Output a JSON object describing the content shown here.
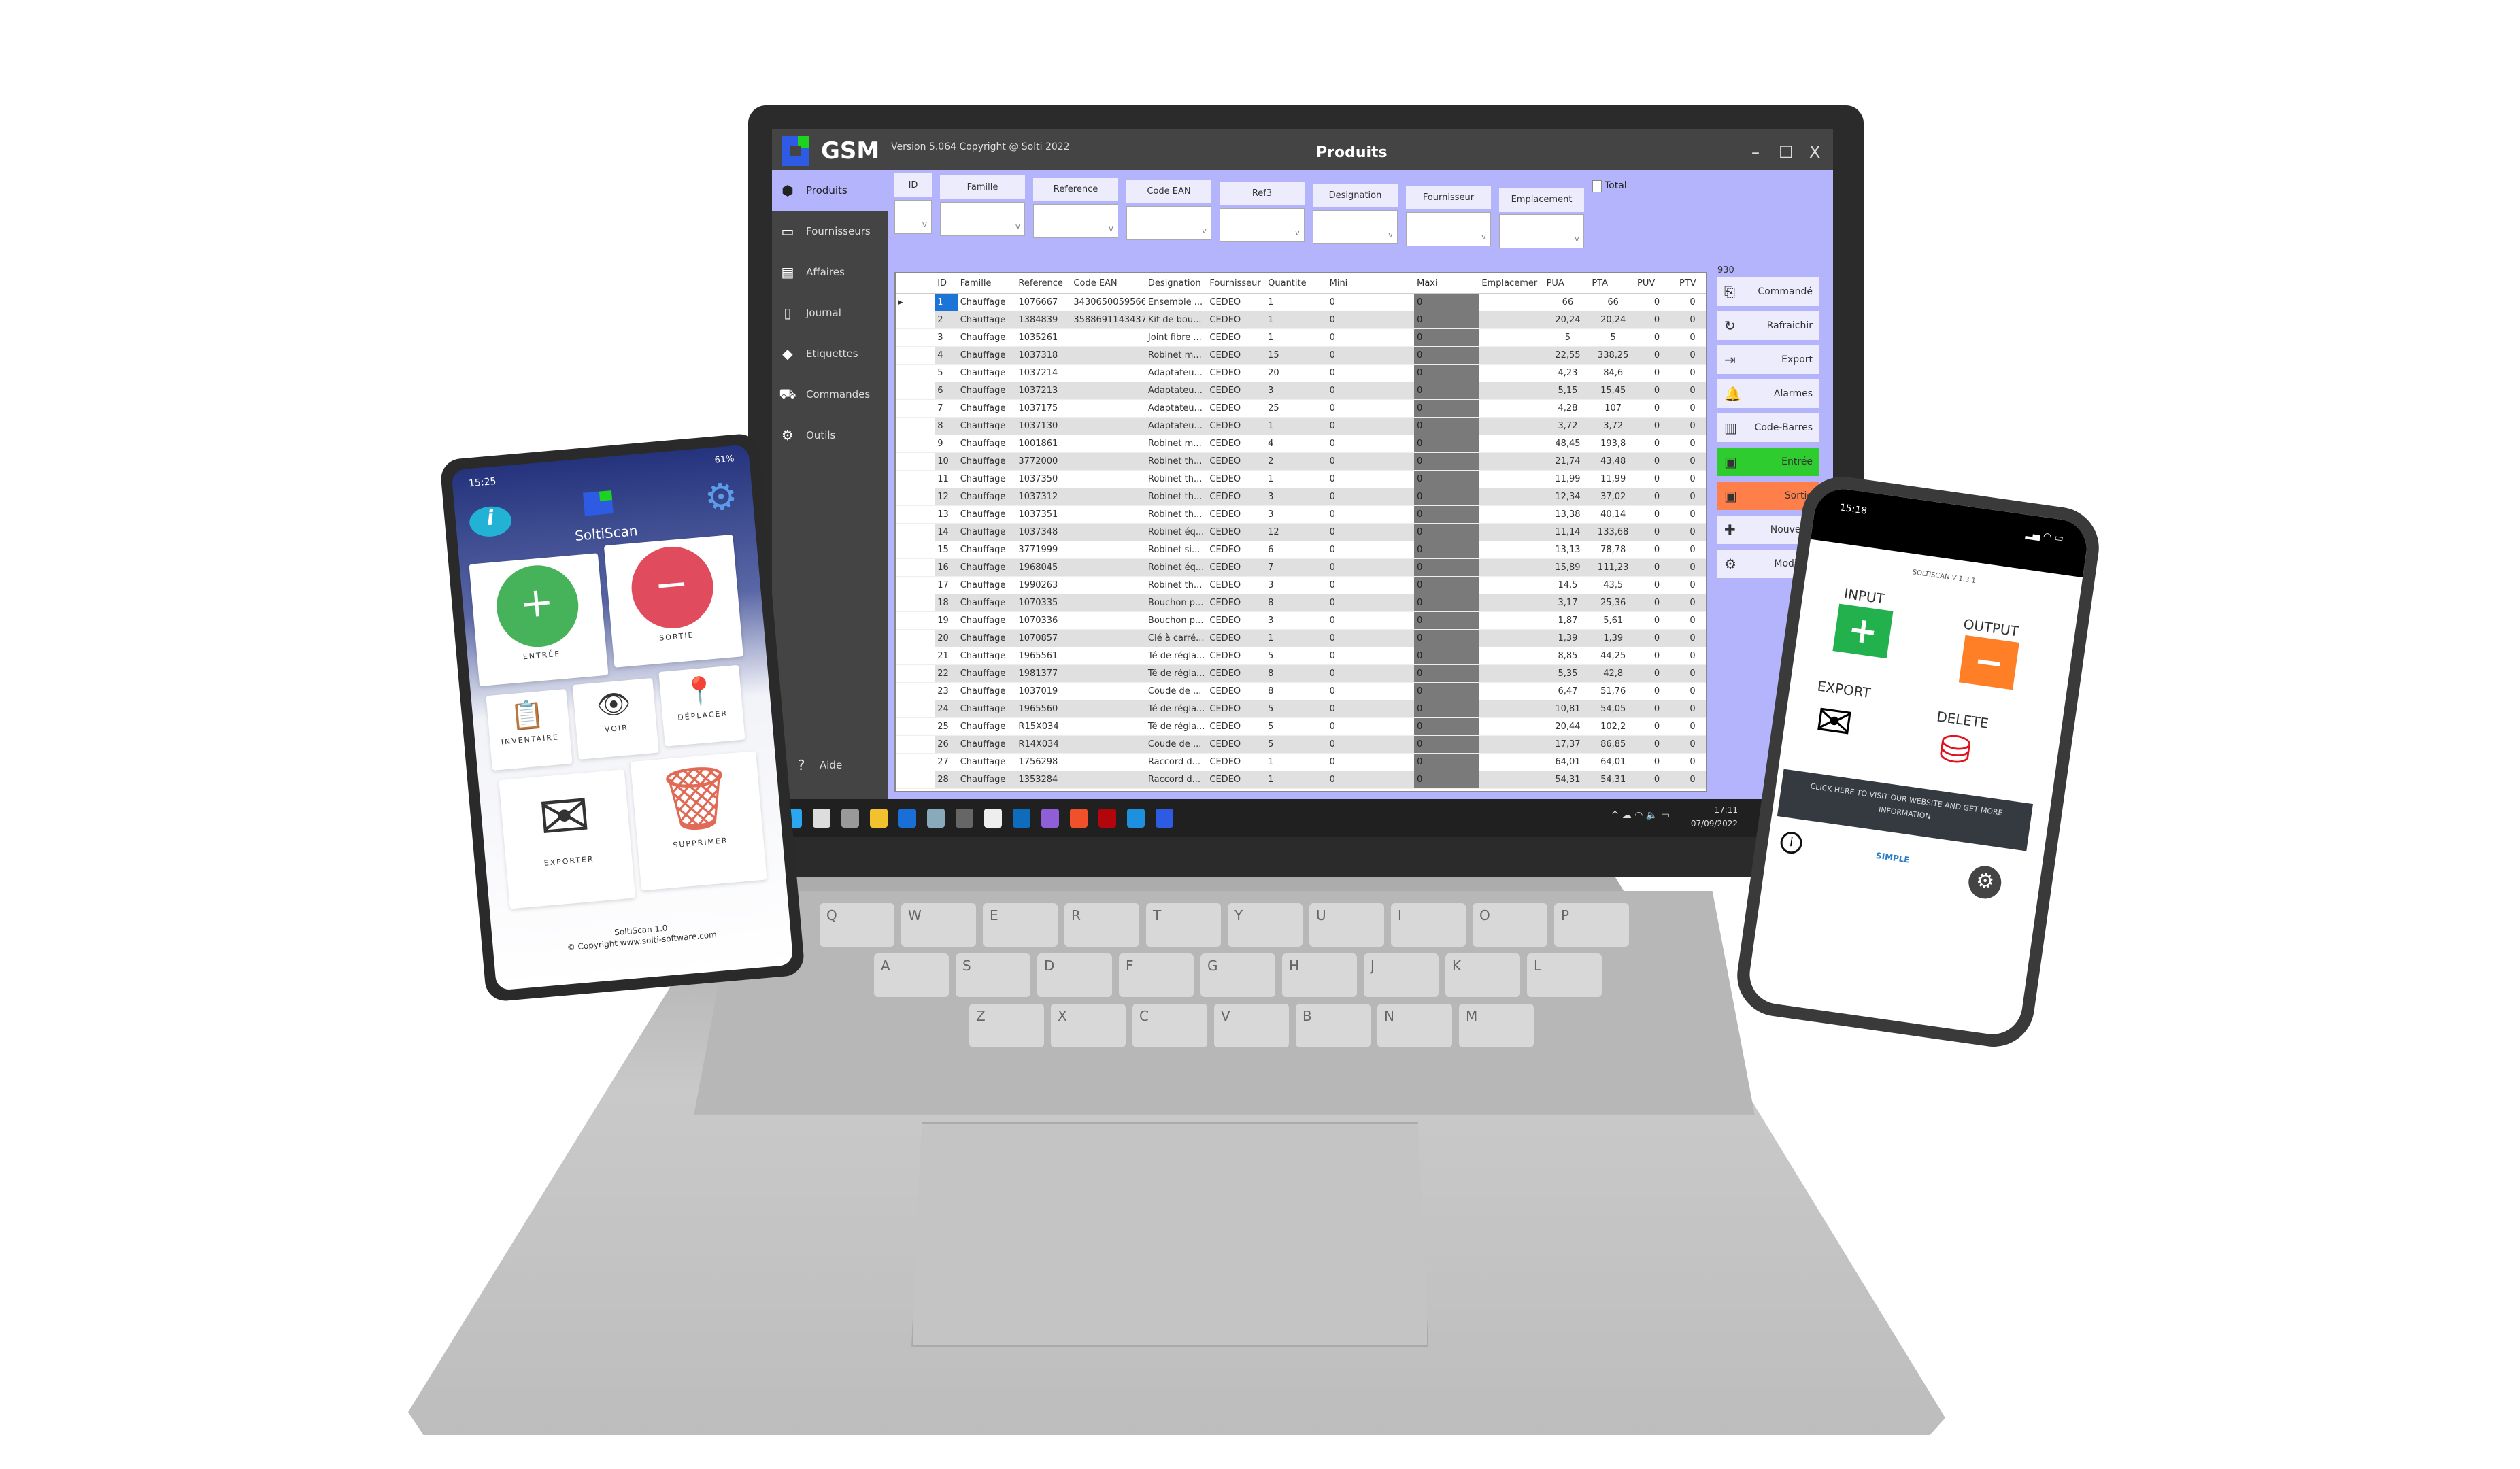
{
  "app": {
    "title": "Produits",
    "version": "Version 5.064  Copyright @ Solti 2022",
    "logo_text": "GSM",
    "window_controls": [
      "–",
      "☐",
      "X"
    ],
    "accent": "#b4b4fc"
  },
  "sidebar": {
    "items": [
      {
        "label": "Produits",
        "icon": "boxes-icon",
        "active": true
      },
      {
        "label": "Fournisseurs",
        "icon": "box-open-icon"
      },
      {
        "label": "Affaires",
        "icon": "briefcase-chart-icon"
      },
      {
        "label": "Journal",
        "icon": "document-icon"
      },
      {
        "label": "Etiquettes",
        "icon": "tags-icon"
      },
      {
        "label": "Commandes",
        "icon": "truck-icon"
      },
      {
        "label": "Outils",
        "icon": "gear-icon"
      }
    ],
    "help": "Aide"
  },
  "filters": {
    "fields": [
      "ID",
      "Famille",
      "Reference",
      "Code EAN",
      "Ref3",
      "Designation",
      "Fournisseur",
      "Emplacement"
    ],
    "total_label": "Total"
  },
  "grid": {
    "columns": [
      "ID",
      "Famille",
      "Reference",
      "Code EAN",
      "Designation",
      "Fournisseur",
      "Quantite",
      "Mini",
      "Maxi",
      "Emplacemer",
      "PUA",
      "PTA",
      "PUV",
      "PTV"
    ],
    "rows": [
      [
        "1",
        "Chauffage",
        "1076667",
        "3430650059566",
        "Ensemble ...",
        "CEDEO",
        "1",
        "0",
        "0",
        "",
        "66",
        "66",
        "0",
        "0"
      ],
      [
        "2",
        "Chauffage",
        "1384839",
        "3588691143437",
        "Kit de bou...",
        "CEDEO",
        "1",
        "0",
        "0",
        "",
        "20,24",
        "20,24",
        "0",
        "0"
      ],
      [
        "3",
        "Chauffage",
        "1035261",
        "",
        "Joint fibre ...",
        "CEDEO",
        "1",
        "0",
        "0",
        "",
        "5",
        "5",
        "0",
        "0"
      ],
      [
        "4",
        "Chauffage",
        "1037318",
        "",
        "Robinet m...",
        "CEDEO",
        "15",
        "0",
        "0",
        "",
        "22,55",
        "338,25",
        "0",
        "0"
      ],
      [
        "5",
        "Chauffage",
        "1037214",
        "",
        "Adaptateu...",
        "CEDEO",
        "20",
        "0",
        "0",
        "",
        "4,23",
        "84,6",
        "0",
        "0"
      ],
      [
        "6",
        "Chauffage",
        "1037213",
        "",
        "Adaptateu...",
        "CEDEO",
        "3",
        "0",
        "0",
        "",
        "5,15",
        "15,45",
        "0",
        "0"
      ],
      [
        "7",
        "Chauffage",
        "1037175",
        "",
        "Adaptateu...",
        "CEDEO",
        "25",
        "0",
        "0",
        "",
        "4,28",
        "107",
        "0",
        "0"
      ],
      [
        "8",
        "Chauffage",
        "1037130",
        "",
        "Adaptateu...",
        "CEDEO",
        "1",
        "0",
        "0",
        "",
        "3,72",
        "3,72",
        "0",
        "0"
      ],
      [
        "9",
        "Chauffage",
        "1001861",
        "",
        "Robinet m...",
        "CEDEO",
        "4",
        "0",
        "0",
        "",
        "48,45",
        "193,8",
        "0",
        "0"
      ],
      [
        "10",
        "Chauffage",
        "3772000",
        "",
        "Robinet th...",
        "CEDEO",
        "2",
        "0",
        "0",
        "",
        "21,74",
        "43,48",
        "0",
        "0"
      ],
      [
        "11",
        "Chauffage",
        "1037350",
        "",
        "Robinet th...",
        "CEDEO",
        "1",
        "0",
        "0",
        "",
        "11,99",
        "11,99",
        "0",
        "0"
      ],
      [
        "12",
        "Chauffage",
        "1037312",
        "",
        "Robinet th...",
        "CEDEO",
        "3",
        "0",
        "0",
        "",
        "12,34",
        "37,02",
        "0",
        "0"
      ],
      [
        "13",
        "Chauffage",
        "1037351",
        "",
        "Robinet th...",
        "CEDEO",
        "3",
        "0",
        "0",
        "",
        "13,38",
        "40,14",
        "0",
        "0"
      ],
      [
        "14",
        "Chauffage",
        "1037348",
        "",
        "Robinet éq...",
        "CEDEO",
        "12",
        "0",
        "0",
        "",
        "11,14",
        "133,68",
        "0",
        "0"
      ],
      [
        "15",
        "Chauffage",
        "3771999",
        "",
        "Robinet si...",
        "CEDEO",
        "6",
        "0",
        "0",
        "",
        "13,13",
        "78,78",
        "0",
        "0"
      ],
      [
        "16",
        "Chauffage",
        "1968045",
        "",
        "Robinet éq...",
        "CEDEO",
        "7",
        "0",
        "0",
        "",
        "15,89",
        "111,23",
        "0",
        "0"
      ],
      [
        "17",
        "Chauffage",
        "1990263",
        "",
        "Robinet th...",
        "CEDEO",
        "3",
        "0",
        "0",
        "",
        "14,5",
        "43,5",
        "0",
        "0"
      ],
      [
        "18",
        "Chauffage",
        "1070335",
        "",
        "Bouchon p...",
        "CEDEO",
        "8",
        "0",
        "0",
        "",
        "3,17",
        "25,36",
        "0",
        "0"
      ],
      [
        "19",
        "Chauffage",
        "1070336",
        "",
        "Bouchon p...",
        "CEDEO",
        "3",
        "0",
        "0",
        "",
        "1,87",
        "5,61",
        "0",
        "0"
      ],
      [
        "20",
        "Chauffage",
        "1070857",
        "",
        "Clé à carré...",
        "CEDEO",
        "1",
        "0",
        "0",
        "",
        "1,39",
        "1,39",
        "0",
        "0"
      ],
      [
        "21",
        "Chauffage",
        "1965561",
        "",
        "Té de régla...",
        "CEDEO",
        "5",
        "0",
        "0",
        "",
        "8,85",
        "44,25",
        "0",
        "0"
      ],
      [
        "22",
        "Chauffage",
        "1981377",
        "",
        "Té de régla...",
        "CEDEO",
        "8",
        "0",
        "0",
        "",
        "5,35",
        "42,8",
        "0",
        "0"
      ],
      [
        "23",
        "Chauffage",
        "1037019",
        "",
        "Coude de ...",
        "CEDEO",
        "8",
        "0",
        "0",
        "",
        "6,47",
        "51,76",
        "0",
        "0"
      ],
      [
        "24",
        "Chauffage",
        "1965560",
        "",
        "Té de régla...",
        "CEDEO",
        "5",
        "0",
        "0",
        "",
        "10,81",
        "54,05",
        "0",
        "0"
      ],
      [
        "25",
        "Chauffage",
        "R15X034",
        "",
        "Té de régla...",
        "CEDEO",
        "5",
        "0",
        "0",
        "",
        "20,44",
        "102,2",
        "0",
        "0"
      ],
      [
        "26",
        "Chauffage",
        "R14X034",
        "",
        "Coude de ...",
        "CEDEO",
        "5",
        "0",
        "0",
        "",
        "17,37",
        "86,85",
        "0",
        "0"
      ],
      [
        "27",
        "Chauffage",
        "1756298",
        "",
        "Raccord d...",
        "CEDEO",
        "1",
        "0",
        "0",
        "",
        "64,01",
        "64,01",
        "0",
        "0"
      ],
      [
        "28",
        "Chauffage",
        "1353284",
        "",
        "Raccord d...",
        "CEDEO",
        "1",
        "0",
        "0",
        "",
        "54,31",
        "54,31",
        "0",
        "0"
      ]
    ]
  },
  "actions": {
    "count": "930",
    "buttons": [
      {
        "label": "Commandé",
        "icon": "document-import-icon"
      },
      {
        "label": "Rafraichir",
        "icon": "refresh-icon"
      },
      {
        "label": "Export",
        "icon": "export-icon"
      },
      {
        "label": "Alarmes",
        "icon": "bell-icon"
      },
      {
        "label": "Code-Barres",
        "icon": "barcode-icon"
      },
      {
        "label": "Entrée",
        "icon": "box-in-icon",
        "color": "#2ecc2e"
      },
      {
        "label": "Sortie",
        "icon": "box-out-icon",
        "color": "#ff7f4a"
      },
      {
        "label": "Nouveau",
        "icon": "new-document-icon"
      },
      {
        "label": "Modifier",
        "icon": "gear-icon"
      }
    ]
  },
  "taskbar": {
    "time": "17:11",
    "date": "07/09/2022",
    "apps": [
      "windows-start-icon",
      "search-icon",
      "task-view-icon",
      "file-explorer-icon",
      "teamviewer-icon",
      "task-manager-icon",
      "calculator-icon",
      "snipping-tool-icon",
      "outlook-icon",
      "visual-studio-icon",
      "brave-icon",
      "filezilla-icon",
      "vscode-icon",
      "gsm-icon"
    ]
  },
  "keyboard": {
    "rows": [
      [
        "Q",
        "W",
        "E",
        "R",
        "T",
        "Y",
        "U",
        "I",
        "O",
        "P"
      ],
      [
        "A",
        "S",
        "D",
        "F",
        "G",
        "H",
        "J",
        "K",
        "L"
      ],
      [
        "Z",
        "X",
        "C",
        "V",
        "B",
        "N",
        "M"
      ]
    ]
  },
  "android_phone": {
    "time": "15:25",
    "battery": "61%",
    "app_name": "SoltiScan",
    "tiles": [
      "ENTRÉE",
      "SORTIE",
      "INVENTAIRE",
      "VOIR",
      "DÉPLACER",
      "EXPORTER",
      "SUPPRIMER"
    ],
    "footer_version": "SoltiScan 1.0",
    "footer_copyright": "© Copyright www.solti-software.com"
  },
  "iphone": {
    "time": "15:18",
    "version": "SOLTISCAN V 1.3.1",
    "input": "INPUT",
    "output": "OUTPUT",
    "export": "EXPORT",
    "delete": "DELETE",
    "banner": "CLICK HERE TO VISIT OUR WEBSITE AND GET MORE INFORMATION",
    "brand": "SIMPLE"
  }
}
